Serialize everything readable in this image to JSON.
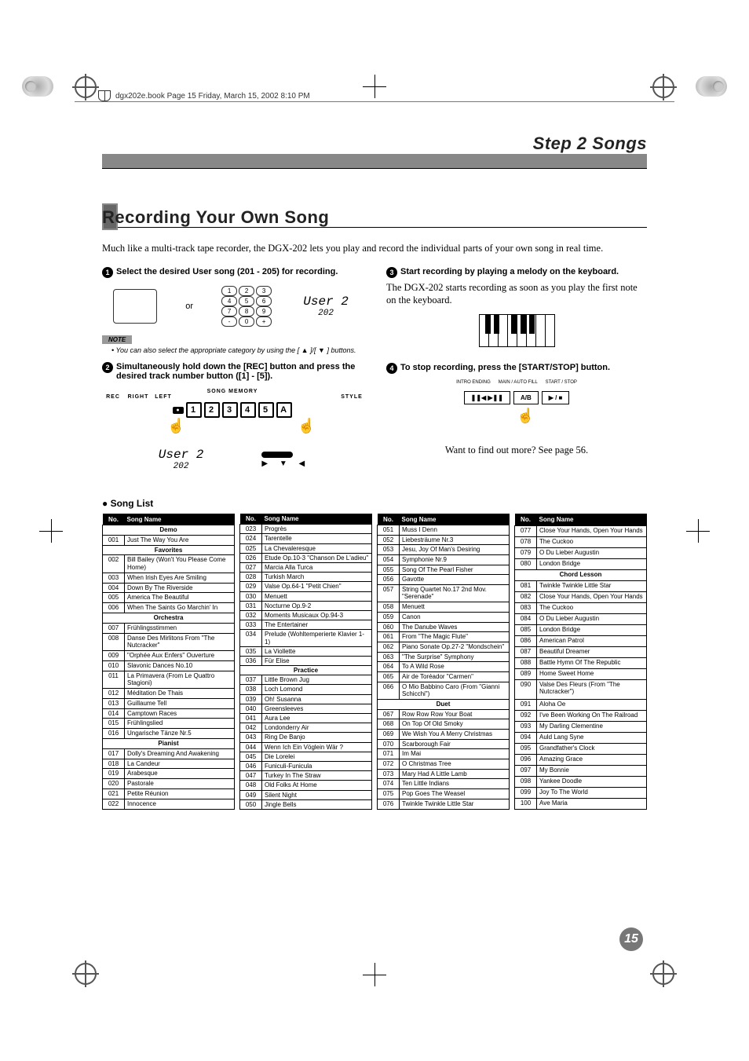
{
  "page_info": "dgx202e.book  Page 15  Friday, March 15, 2002  8:10 PM",
  "step_header": "Step 2 Songs",
  "recording_title": "Recording Your Own Song",
  "intro_text": "Much like a multi-track tape recorder, the DGX-202 lets you play and record the individual parts of your own song in real time.",
  "step1_label": "Select the desired User song (201 - 205) for recording.",
  "or_text": "or",
  "lcd_text": "User 2",
  "lcd_num": "202",
  "note_label": "NOTE",
  "note_text": "• You can also select the appropriate category by using the [ ▲ ]/[ ▼ ] buttons.",
  "step2_label": "Simultaneously hold down the [REC] button and press the desired track number button ([1] - [5]).",
  "song_memory_label": "SONG MEMORY",
  "mem_labels": {
    "rec": "REC",
    "right": "RIGHT",
    "left": "LEFT",
    "style": "STYLE"
  },
  "mem_rec": "●",
  "mem_buttons": [
    "1",
    "2",
    "3",
    "4",
    "5",
    "A"
  ],
  "step3_label": "Start recording by playing a melody on the keyboard.",
  "step3_body": "The DGX-202 starts recording as soon as you play the first note on the keyboard.",
  "step4_label": "To stop recording, press the [START/STOP] button.",
  "transport_labels": {
    "intro": "INTRO ENDING",
    "main": "MAIN / AUTO FILL",
    "start": "START / STOP"
  },
  "transport_btns": {
    "pause": "❚❚◀ ▶❚❚",
    "ab": "A/B",
    "play": "▶ / ■"
  },
  "find_more": "Want to find out more?  See page 56.",
  "song_list_title": "Song List",
  "table_header_no": "No.",
  "table_header_name": "Song Name",
  "tables": [
    [
      {
        "section": "Demo"
      },
      {
        "no": "001",
        "name": "Just The Way You Are"
      },
      {
        "section": "Favorites"
      },
      {
        "no": "002",
        "name": "Bill Bailey (Won't You Please Come Home)"
      },
      {
        "no": "003",
        "name": "When Irish Eyes Are Smiling"
      },
      {
        "no": "004",
        "name": "Down By The Riverside"
      },
      {
        "no": "005",
        "name": "America The Beautiful"
      },
      {
        "no": "006",
        "name": "When The Saints Go Marchin' In"
      },
      {
        "section": "Orchestra"
      },
      {
        "no": "007",
        "name": "Frühlingsstimmen"
      },
      {
        "no": "008",
        "name": "Danse Des Mirlitons From \"The Nutcracker\""
      },
      {
        "no": "009",
        "name": "\"Orphée Aux Enfers\" Ouverture"
      },
      {
        "no": "010",
        "name": "Slavonic Dances No.10"
      },
      {
        "no": "011",
        "name": "La Primavera (From Le Quattro Stagioni)"
      },
      {
        "no": "012",
        "name": "Méditation De Thais"
      },
      {
        "no": "013",
        "name": "Guillaume Tell"
      },
      {
        "no": "014",
        "name": "Camptown Races"
      },
      {
        "no": "015",
        "name": "Frühlingslied"
      },
      {
        "no": "016",
        "name": "Ungarische Tänze Nr.5"
      },
      {
        "section": "Pianist"
      },
      {
        "no": "017",
        "name": "Dolly's Dreaming And Awakening"
      },
      {
        "no": "018",
        "name": "La Candeur"
      },
      {
        "no": "019",
        "name": "Arabesque"
      },
      {
        "no": "020",
        "name": "Pastorale"
      },
      {
        "no": "021",
        "name": "Petite Réunion"
      },
      {
        "no": "022",
        "name": "Innocence"
      }
    ],
    [
      {
        "no": "023",
        "name": "Progrès"
      },
      {
        "no": "024",
        "name": "Tarentelle"
      },
      {
        "no": "025",
        "name": "La Chevaleresque"
      },
      {
        "no": "026",
        "name": "Etude Op.10-3 \"Chanson De L'adieu\""
      },
      {
        "no": "027",
        "name": "Marcia Alla Turca"
      },
      {
        "no": "028",
        "name": "Turkish March"
      },
      {
        "no": "029",
        "name": "Valse Op.64-1 \"Petit Chien\""
      },
      {
        "no": "030",
        "name": "Menuett"
      },
      {
        "no": "031",
        "name": "Nocturne Op.9-2"
      },
      {
        "no": "032",
        "name": "Moments Musicaux Op.94-3"
      },
      {
        "no": "033",
        "name": "The Entertainer"
      },
      {
        "no": "034",
        "name": "Prelude (Wohltemperierte Klavier 1-1)"
      },
      {
        "no": "035",
        "name": "La Viollette"
      },
      {
        "no": "036",
        "name": "Für Elise"
      },
      {
        "section": "Practice"
      },
      {
        "no": "037",
        "name": "Little Brown Jug"
      },
      {
        "no": "038",
        "name": "Loch Lomond"
      },
      {
        "no": "039",
        "name": "Oh! Susanna"
      },
      {
        "no": "040",
        "name": "Greensleeves"
      },
      {
        "no": "041",
        "name": "Aura Lee"
      },
      {
        "no": "042",
        "name": "Londonderry Air"
      },
      {
        "no": "043",
        "name": "Ring De Banjo"
      },
      {
        "no": "044",
        "name": "Wenn Ich Ein Vöglein Wär ?"
      },
      {
        "no": "045",
        "name": "Die Lorelei"
      },
      {
        "no": "046",
        "name": "Funiculi-Funicula"
      },
      {
        "no": "047",
        "name": "Turkey In The Straw"
      },
      {
        "no": "048",
        "name": "Old Folks At Home"
      },
      {
        "no": "049",
        "name": "Silent Night"
      },
      {
        "no": "050",
        "name": "Jingle Bells"
      }
    ],
    [
      {
        "no": "051",
        "name": "Muss I Denn"
      },
      {
        "no": "052",
        "name": "Liebesträume Nr.3"
      },
      {
        "no": "053",
        "name": "Jesu, Joy Of Man's Desiring"
      },
      {
        "no": "054",
        "name": "Symphonie Nr.9"
      },
      {
        "no": "055",
        "name": "Song Of The Pearl Fisher"
      },
      {
        "no": "056",
        "name": "Gavotte"
      },
      {
        "no": "057",
        "name": "String Quartet No.17 2nd Mov. \"Serenade\""
      },
      {
        "no": "058",
        "name": "Menuett"
      },
      {
        "no": "059",
        "name": "Canon"
      },
      {
        "no": "060",
        "name": "The Danube Waves"
      },
      {
        "no": "061",
        "name": "From \"The Magic Flute\""
      },
      {
        "no": "062",
        "name": "Piano Sonate Op.27-2 \"Mondschein\""
      },
      {
        "no": "063",
        "name": "\"The Surprise\" Symphony"
      },
      {
        "no": "064",
        "name": "To A Wild Rose"
      },
      {
        "no": "065",
        "name": "Air de Toréador \"Carmen\""
      },
      {
        "no": "066",
        "name": "O Mio Babbino Caro (From \"Gianni Schicchi\")"
      },
      {
        "section": "Duet"
      },
      {
        "no": "067",
        "name": "Row Row Row Your Boat"
      },
      {
        "no": "068",
        "name": "On Top Of Old Smoky"
      },
      {
        "no": "069",
        "name": "We Wish You A Merry Christmas"
      },
      {
        "no": "070",
        "name": "Scarborough Fair"
      },
      {
        "no": "071",
        "name": "Im Mai"
      },
      {
        "no": "072",
        "name": "O Christmas Tree"
      },
      {
        "no": "073",
        "name": "Mary Had A Little Lamb"
      },
      {
        "no": "074",
        "name": "Ten Little Indians"
      },
      {
        "no": "075",
        "name": "Pop Goes The Weasel"
      },
      {
        "no": "076",
        "name": "Twinkle Twinkle Little Star"
      }
    ],
    [
      {
        "no": "077",
        "name": "Close Your Hands, Open Your Hands"
      },
      {
        "no": "078",
        "name": "The Cuckoo"
      },
      {
        "no": "079",
        "name": "O Du Lieber Augustin"
      },
      {
        "no": "080",
        "name": "London Bridge"
      },
      {
        "section": "Chord Lesson"
      },
      {
        "no": "081",
        "name": "Twinkle Twinkle Little Star"
      },
      {
        "no": "082",
        "name": "Close Your Hands, Open Your Hands"
      },
      {
        "no": "083",
        "name": "The Cuckoo"
      },
      {
        "no": "084",
        "name": "O Du Lieber Augustin"
      },
      {
        "no": "085",
        "name": "London Bridge"
      },
      {
        "no": "086",
        "name": "American Patrol"
      },
      {
        "no": "087",
        "name": "Beautiful Dreamer"
      },
      {
        "no": "088",
        "name": "Battle Hymn Of The Republic"
      },
      {
        "no": "089",
        "name": "Home Sweet Home"
      },
      {
        "no": "090",
        "name": "Valse Des Fleurs (From \"The Nutcracker\")"
      },
      {
        "no": "091",
        "name": "Aloha Oe"
      },
      {
        "no": "092",
        "name": "I've Been Working On The Railroad"
      },
      {
        "no": "093",
        "name": "My Darling Clementine"
      },
      {
        "no": "094",
        "name": "Auld Lang Syne"
      },
      {
        "no": "095",
        "name": "Grandfather's Clock"
      },
      {
        "no": "096",
        "name": "Amazing Grace"
      },
      {
        "no": "097",
        "name": "My Bonnie"
      },
      {
        "no": "098",
        "name": "Yankee Doodle"
      },
      {
        "no": "099",
        "name": "Joy To The World"
      },
      {
        "no": "100",
        "name": "Ave Maria"
      }
    ]
  ],
  "page_number": "15"
}
